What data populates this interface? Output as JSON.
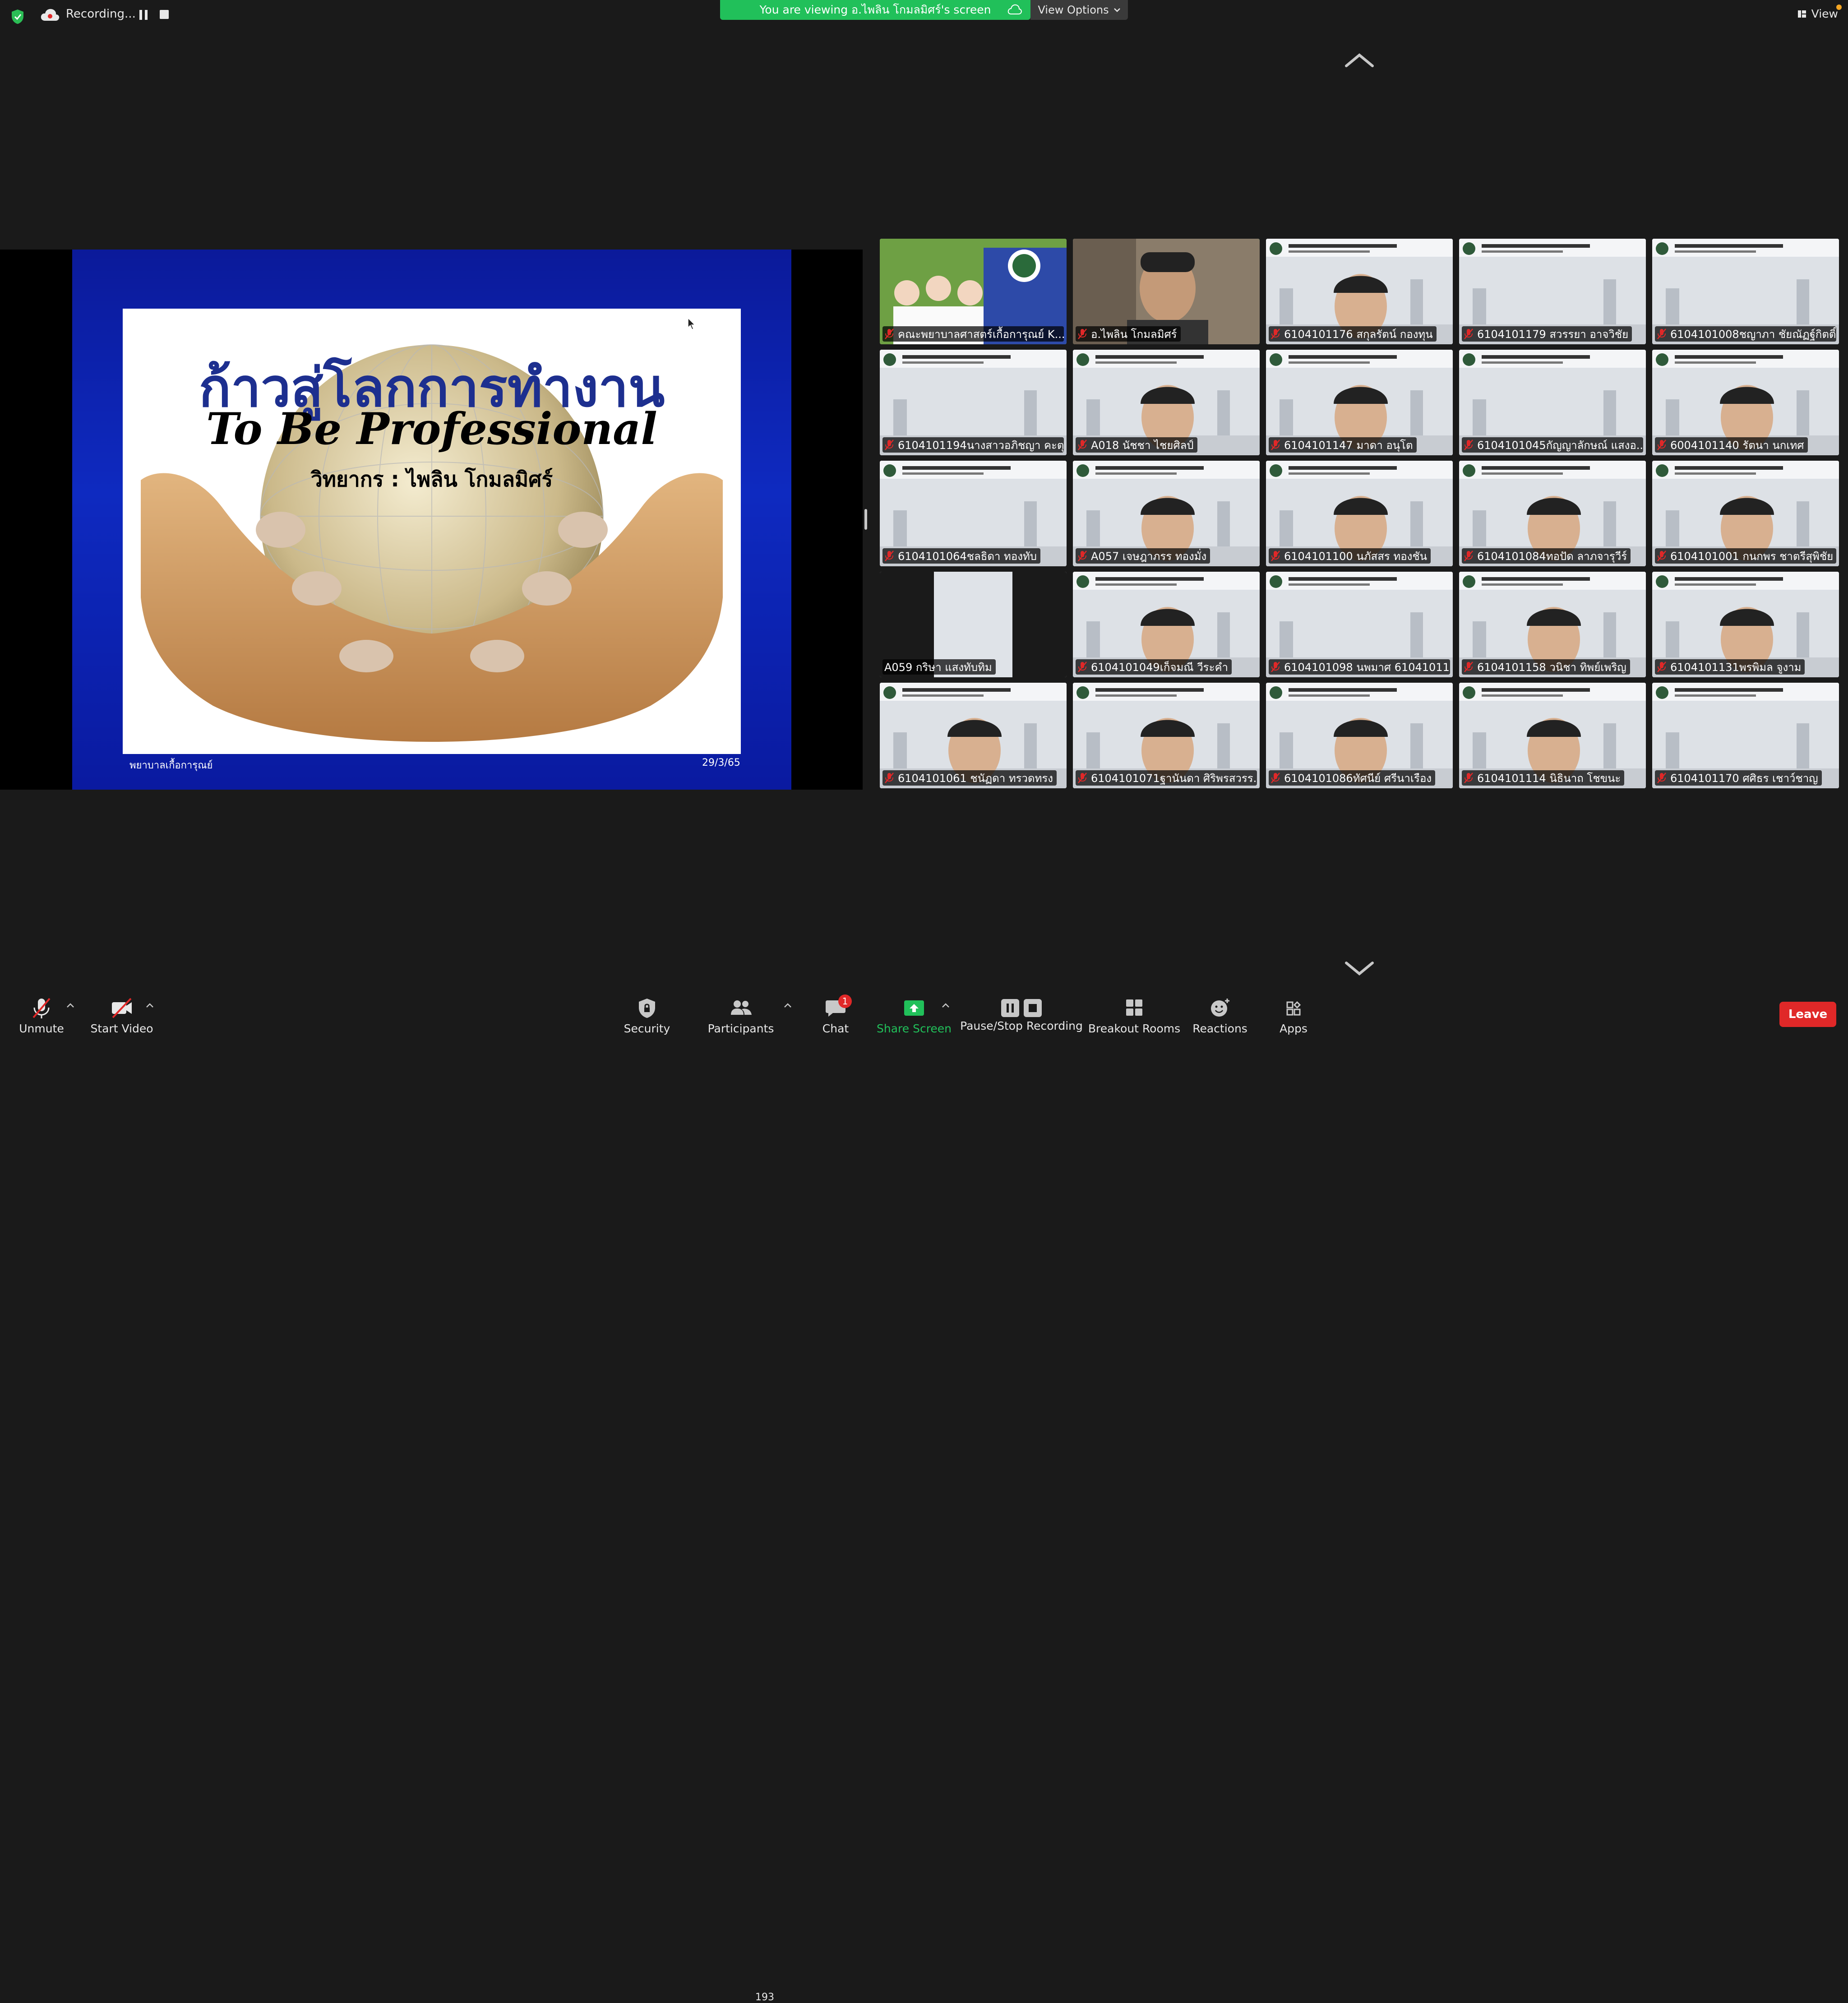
{
  "topbar": {
    "recording_label": "Recording...",
    "viewing_banner": "You are viewing อ.ไพลิน โกมลมิศร์'s screen",
    "view_options_label": "View Options",
    "view_label": "View"
  },
  "slide": {
    "title_th": "ก้าวสู่โลกการทำงาน",
    "title_en": "To Be Professional",
    "speaker": "วิทยากร : ไพลิน โกมลมิศร์",
    "footer_left": "พยาบาลเกื้อการุณย์",
    "footer_right": "29/3/65"
  },
  "participants": [
    {
      "name": "คณะพยาบาลศาสตร์เกื้อการุณย์ K..."
    },
    {
      "name": "อ.ไพลิน โกมลมิศร์"
    },
    {
      "name": "6104101176 สกุลรัตน์ กองทุน"
    },
    {
      "name": "6104101179 สวรรยา อาจวิชัย"
    },
    {
      "name": "6104101008ชญาภา ชัยณัฏฐ์กิตติ์"
    },
    {
      "name": "6104101194นางสาวอภิชญา คะตุน"
    },
    {
      "name": "A018 นัชชา ไชยศิลป์"
    },
    {
      "name": "6104101147 มาดา อนุโต"
    },
    {
      "name": "6104101045กัญญาลักษณ์ แสงอ..."
    },
    {
      "name": "6004101140 รัตนา นกเทศ"
    },
    {
      "name": "6104101064ชลธิดา ทองทับ"
    },
    {
      "name": "A057 เจษฎาภรร ทองมั่ง"
    },
    {
      "name": "6104101100 นภัสสร ทองชัน"
    },
    {
      "name": "6104101084ทอปัด ลาภจารุวีร์"
    },
    {
      "name": "6104101001 กนกพร ชาตรีสุพิชัย"
    },
    {
      "name": "A059 กริษา แสงทับทิม"
    },
    {
      "name": "6104101049เก็จมณี วีระคำ"
    },
    {
      "name": "6104101098 นพมาศ 61041011..."
    },
    {
      "name": "6104101158 วนิชา ทิพย์เพริญ"
    },
    {
      "name": "6104101131พรพิมล จูงาม"
    },
    {
      "name": "6104101061 ชนัฏดา ทรวดทรง"
    },
    {
      "name": "6104101071ฐานันดา ศิริพรสวรร..."
    },
    {
      "name": "6104101086ทัศนีย์ ศรีนาเรือง"
    },
    {
      "name": "6104101114 นิธินาถ โชขนะ"
    },
    {
      "name": "6104101170 ศศิธร เชาว์ชาญ"
    }
  ],
  "toolbar": {
    "unmute": "Unmute",
    "start_video": "Start Video",
    "security": "Security",
    "participants": "Participants",
    "participants_count": "193",
    "chat": "Chat",
    "chat_badge": "1",
    "share_screen": "Share Screen",
    "pause_stop": "Pause/Stop Recording",
    "breakout": "Breakout Rooms",
    "reactions": "Reactions",
    "apps": "Apps",
    "leave": "Leave"
  },
  "colors": {
    "accent_green": "#21c05a",
    "leave_red": "#e02828",
    "slide_blue": "#1d2f8f"
  }
}
